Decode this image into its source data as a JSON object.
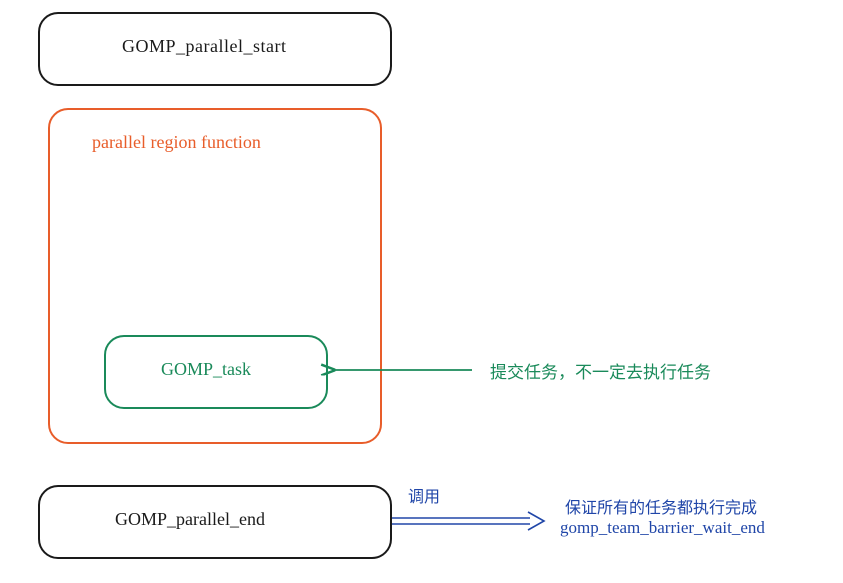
{
  "boxes": {
    "parallel_start": "GOMP_parallel_start",
    "region_label": "parallel region function",
    "task": "GOMP_task",
    "parallel_end": "GOMP_parallel_end"
  },
  "annotations": {
    "task_note": "提交任务，不一定去执行任务",
    "call_label": "调用",
    "barrier_note": "保证所有的任务都执行完成",
    "barrier_func": "gomp_team_barrier_wait_end"
  }
}
